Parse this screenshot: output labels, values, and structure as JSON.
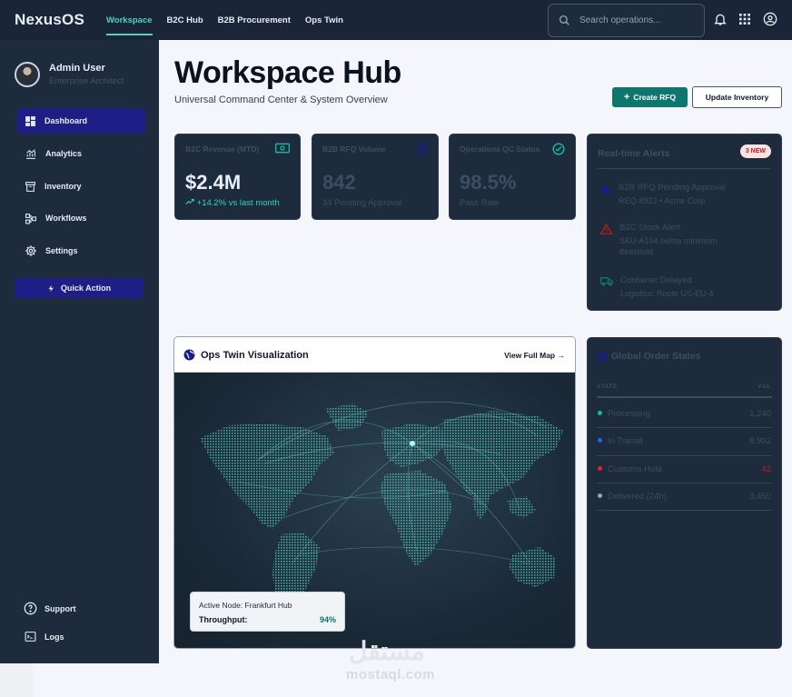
{
  "app": {
    "brand": "NexusOS"
  },
  "nav": {
    "items": [
      {
        "label": "Workspace",
        "active": true
      },
      {
        "label": "B2C Hub"
      },
      {
        "label": "B2B Procurement"
      },
      {
        "label": "Ops Twin"
      }
    ],
    "search_placeholder": "Search operations..."
  },
  "sidebar": {
    "user_name": "Admin User",
    "user_role": "Enterprise Architect",
    "items": [
      {
        "label": "Dashboard",
        "icon": "dashboard-icon",
        "active": true
      },
      {
        "label": "Analytics",
        "icon": "analytics-icon"
      },
      {
        "label": "Inventory",
        "icon": "inventory-icon"
      },
      {
        "label": "Workflows",
        "icon": "workflows-icon"
      },
      {
        "label": "Settings",
        "icon": "gear-icon"
      }
    ],
    "quick_action": "Quick Action",
    "support": "Support",
    "logs": "Logs"
  },
  "header": {
    "title": "Workspace Hub",
    "subtitle": "Universal Command Center & System Overview",
    "create_rfq": "Create RFQ",
    "update_inventory": "Update Inventory"
  },
  "kpis": [
    {
      "label": "B2C Revenue (MTD)",
      "value": "$2.4M",
      "sub": "+14.2% vs last month",
      "icon": "money-icon"
    },
    {
      "label": "B2B RFQ Volume",
      "value": "842",
      "sub": "34 Pending Approval",
      "icon": "document-icon"
    },
    {
      "label": "Operations QC Status",
      "value": "98.5%",
      "sub": "Pass Rate",
      "icon": "check-circle-icon"
    }
  ],
  "alerts": {
    "title": "Real-time Alerts",
    "badge": "3 NEW",
    "items": [
      {
        "title": "B2B RFQ Pending Approval",
        "detail": "REQ-8922 • Acme Corp",
        "icon": "building-icon"
      },
      {
        "title": "B2C Stock Alert",
        "detail": "SKU-A104 below minimum threshold",
        "icon": "warning-icon"
      },
      {
        "title": "Container Delayed",
        "detail": "Logistics: Route US-EU-4",
        "icon": "truck-icon"
      }
    ]
  },
  "map": {
    "title": "Ops Twin Visualization",
    "link": "View Full Map →",
    "node_label": "Active Node: Frankfurt Hub",
    "throughput_label": "Throughput:",
    "throughput_value": "94%"
  },
  "orders": {
    "title": "Global Order States",
    "col_state": "STATE",
    "col_vol": "VOL",
    "rows": [
      {
        "state": "Processing",
        "vol": "1,240",
        "color": "#14b8a6"
      },
      {
        "state": "In Transit",
        "vol": "8,902",
        "color": "#2563eb"
      },
      {
        "state": "Customs Hold",
        "vol": "42",
        "color": "#dc2626"
      },
      {
        "state": "Delivered (24h)",
        "vol": "3,450",
        "color": "#9ca3af"
      }
    ]
  },
  "watermark": {
    "arabic": "مستقل",
    "latin": "mostaql.com"
  }
}
